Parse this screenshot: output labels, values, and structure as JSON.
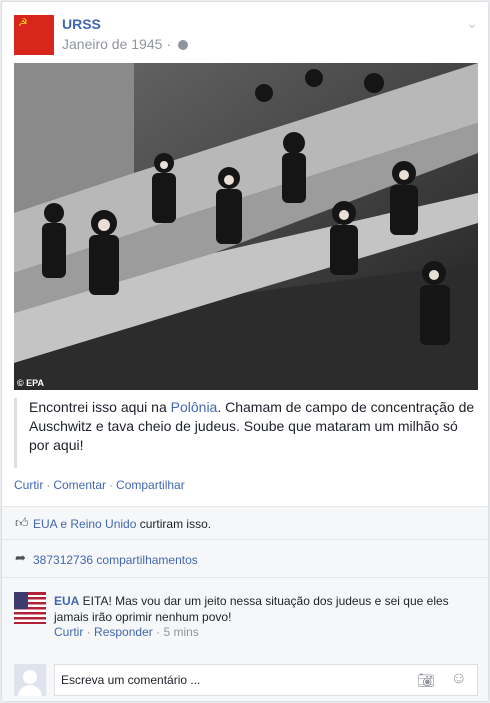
{
  "post": {
    "author": "URSS",
    "date": "Janeiro de 1945",
    "separator": "·",
    "privacy_icon": "globe-icon",
    "menu_icon": "chevron-down-icon",
    "photo_credit": "© EPA",
    "text_before_link": "Encontrei isso aqui na ",
    "text_link": "Polônia",
    "text_after_link": ". Chamam de campo de concentração de Auschwitz e tava cheio de judeus. Soube que mataram um milhão só por aqui!"
  },
  "actions": {
    "like": "Curtir",
    "comment": "Comentar",
    "share": "Compartilhar",
    "separator": "·"
  },
  "likes": {
    "icon": "thumbs-up-icon",
    "names": "EUA e Reino Unido",
    "suffix": " curtiram isso."
  },
  "shares": {
    "icon": "share-arrow-icon",
    "text": "387312736 compartilhamentos"
  },
  "comment": {
    "author": "EUA",
    "text": " EITA! Mas vou dar um jeito nessa situação dos judeus e sei que eles jamais irão oprimir nenhum povo!",
    "like": "Curtir",
    "reply": "Responder",
    "time": "5 mins",
    "separator": "·"
  },
  "reply_box": {
    "placeholder": "Escreva um comentário ...",
    "camera_icon": "camera-icon",
    "emoji_icon": "smiley-icon"
  },
  "colors": {
    "link": "#4267b2",
    "flag_red": "#d9261c",
    "flag_gold": "#f5d31a",
    "muted": "#90949c"
  }
}
